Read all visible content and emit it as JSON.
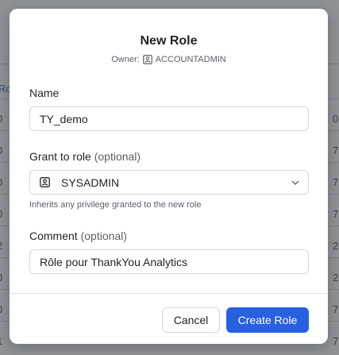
{
  "background": {
    "heading_fragment": "Ro",
    "left_column": [
      "0",
      "0",
      "0",
      "0",
      "2",
      "0",
      "0",
      "1"
    ],
    "right_column": [
      "0",
      "7",
      "7",
      "7",
      "2",
      "2",
      "7",
      "7"
    ]
  },
  "modal": {
    "title": "New Role",
    "owner_prefix": "Owner:",
    "owner_value": "ACCOUNTADMIN",
    "name_label": "Name",
    "name_value": "TY_demo",
    "grant_label": "Grant to role",
    "grant_optional": "(optional)",
    "grant_value": "SYSADMIN",
    "grant_hint": "Inherits any privilege granted to the new role",
    "comment_label": "Comment",
    "comment_optional": "(optional)",
    "comment_value": "Rôle pour ThankYou Analytics",
    "cancel_label": "Cancel",
    "create_label": "Create Role"
  },
  "colors": {
    "primary": "#2761e0",
    "overlay": "#8f9296"
  },
  "icons": [
    "role-icon",
    "chevron-down-icon"
  ]
}
